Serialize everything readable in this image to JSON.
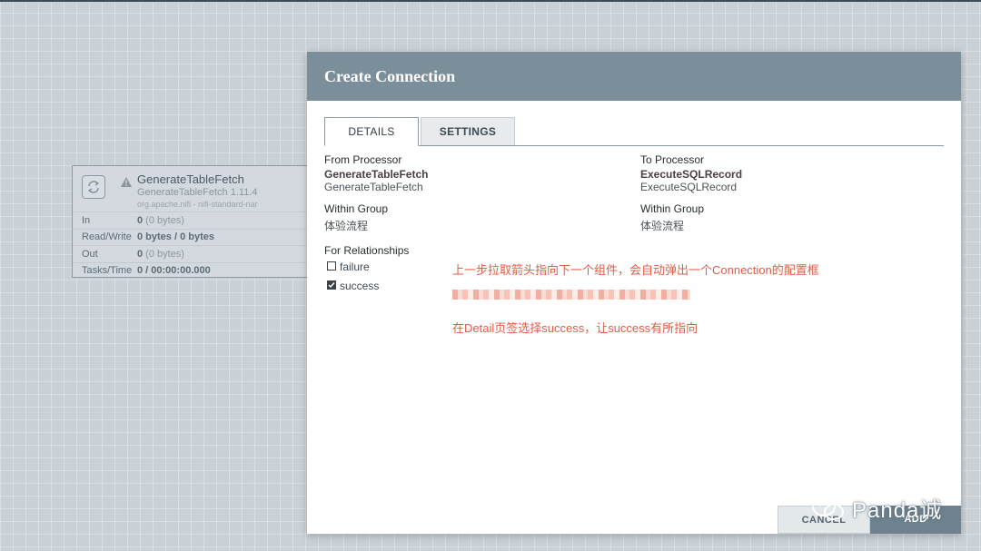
{
  "processor": {
    "name": "GenerateTableFetch",
    "type": "GenerateTableFetch 1.11.4",
    "bundle": "org.apache.nifi - nifi-standard-nar",
    "stats": [
      {
        "label": "In",
        "bold": "0",
        "rest": " (0 bytes)"
      },
      {
        "label": "Read/Write",
        "bold": "0 bytes / 0 bytes",
        "rest": ""
      },
      {
        "label": "Out",
        "bold": "0",
        "rest": " (0 bytes)"
      },
      {
        "label": "Tasks/Time",
        "bold": "0 / 00:00:00.000",
        "rest": ""
      }
    ]
  },
  "dialog": {
    "title": "Create Connection",
    "tabs": {
      "details": "DETAILS",
      "settings": "SETTINGS"
    },
    "from": {
      "label": "From Processor",
      "name": "GenerateTableFetch",
      "type": "GenerateTableFetch",
      "group_label": "Within Group",
      "group": "体验流程"
    },
    "to": {
      "label": "To Processor",
      "name": "ExecuteSQLRecord",
      "type": "ExecuteSQLRecord",
      "group_label": "Within Group",
      "group": "体验流程"
    },
    "relationships": {
      "label": "For Relationships",
      "items": [
        {
          "name": "failure",
          "checked": false
        },
        {
          "name": "success",
          "checked": true
        }
      ]
    },
    "notes": {
      "line1": "上一步拉取箭头指向下一个组件，会自动弹出一个Connection的配置框",
      "line3": "在Detail页签选择success，让success有所指向"
    },
    "buttons": {
      "cancel": "CANCEL",
      "add": "ADD"
    }
  },
  "watermark": "Panda诚",
  "colors": {
    "header": "#7b8f9b",
    "note": "#e05c45",
    "canvas": "#c9d1d7"
  }
}
